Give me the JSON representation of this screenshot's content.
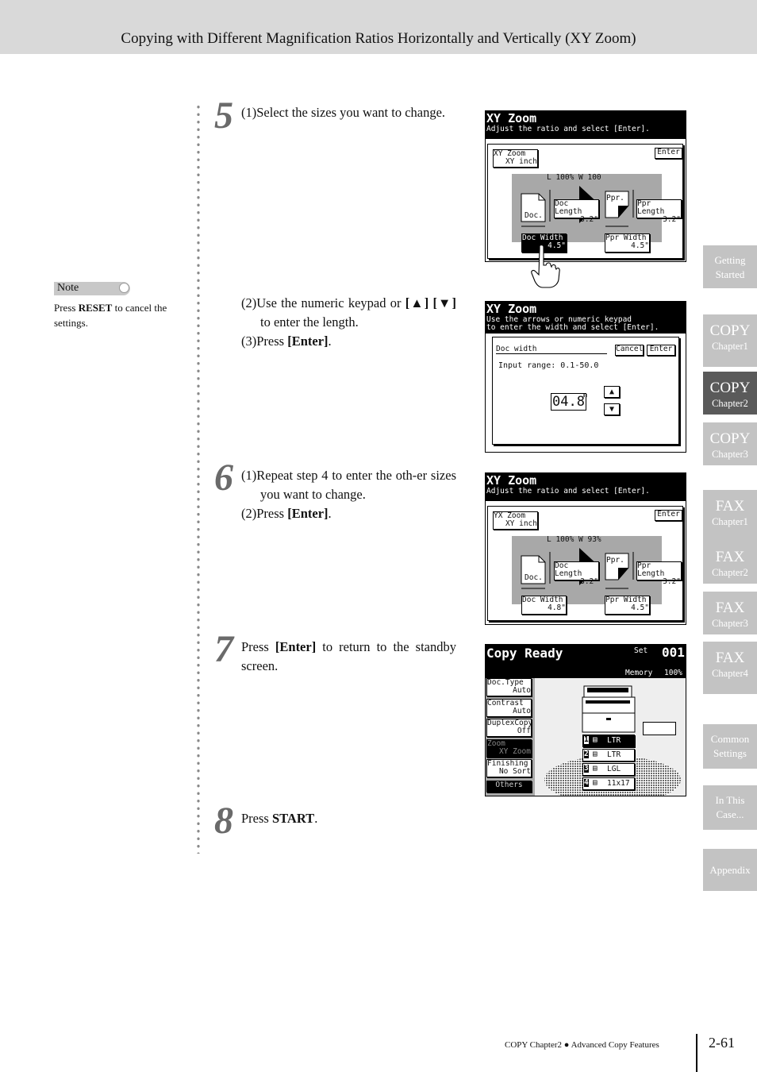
{
  "header": {
    "title": "Copying with Different Magnification Ratios Horizontally and Vertically (XY Zoom)"
  },
  "note": {
    "label": "Note",
    "text_pre": "Press ",
    "reset_key": "RESET",
    "text_post": " to cancel the settings."
  },
  "steps": {
    "s5": {
      "num": "5",
      "sub1_num": "(1)",
      "sub1": "Select the sizes you want to change.",
      "sub2_num": "(2)",
      "sub2_pre": "Use the numeric keypad or ",
      "sub2_keys": "[▲] [▼]",
      "sub2_post": " to enter the length.",
      "sub3_num": "(3)",
      "sub3_pre": "Press ",
      "sub3_key": "[Enter]",
      "sub3_post": "."
    },
    "s6": {
      "num": "6",
      "sub1_num": "(1)",
      "sub1": "Repeat step 4 to enter the oth-er sizes you want to change.",
      "sub2_num": "(2)",
      "sub2_pre": "Press ",
      "sub2_key": "[Enter]",
      "sub2_post": "."
    },
    "s7": {
      "num": "7",
      "pre": "Press ",
      "key": "[Enter]",
      "post": " to return to the standby screen."
    },
    "s8": {
      "num": "8",
      "pre": "Press ",
      "key": "START",
      "post": "."
    }
  },
  "screen1": {
    "title": "XY Zoom",
    "subtitle": "Adjust the ratio and select [Enter].",
    "mode_l1": "XY Zoom",
    "mode_l2": "XY inch",
    "enter": "Enter",
    "ratio": "L  100% W  100",
    "doc": "Doc.",
    "ppr": "Ppr.",
    "doc_length_label": "Doc Length",
    "doc_length_val": "3.2\"",
    "ppr_length_label": "Ppr Length",
    "ppr_length_val": "3.2\"",
    "doc_width_label": "Doc Width",
    "doc_width_val": "4.5\"",
    "ppr_width_label": "Ppr Width",
    "ppr_width_val": "4.5\""
  },
  "screen2": {
    "title": "XY Zoom",
    "subtitle1": "Use the arrows or numeric keypad",
    "subtitle2": "to enter the width and select [Enter].",
    "field": "Doc width",
    "cancel": "Cancel",
    "enter": "Enter",
    "range": "Input range: 0.1-50.0",
    "value": "04.8",
    "unit": "\""
  },
  "screen3": {
    "title": "XY Zoom",
    "subtitle": "Adjust the ratio and select [Enter].",
    "mode_l1": "YX Zoom",
    "mode_l2": "XY inch",
    "enter": "Enter",
    "ratio": "L  100% W   93%",
    "doc": "Doc.",
    "ppr": "Ppr.",
    "doc_length_label": "Doc Length",
    "doc_length_val": "3.2\"",
    "ppr_length_label": "Ppr Length",
    "ppr_length_val": "3.2\"",
    "doc_width_label": "Doc Width",
    "doc_width_val": "4.8\"",
    "ppr_width_label": "Ppr Width",
    "ppr_width_val": "4.5\""
  },
  "screen4": {
    "title": "Copy Ready",
    "set_label": "Set",
    "set_value": "001",
    "memory_label": "Memory",
    "memory_value": "100%",
    "items": [
      {
        "label": "Doc.Type",
        "value": "Auto"
      },
      {
        "label": "Contrast",
        "value": "Auto"
      },
      {
        "label": "DuplexCopy",
        "value": "Off"
      },
      {
        "label": "Zoom",
        "value": "XY Zoom"
      },
      {
        "label": "Finishing",
        "value": "No Sort"
      }
    ],
    "others": "Others",
    "trays": [
      {
        "num": "1",
        "size": "LTR"
      },
      {
        "num": "2",
        "size": "LTR"
      },
      {
        "num": "3",
        "size": "LGL"
      },
      {
        "num": "4",
        "size": "11x17"
      }
    ]
  },
  "tabs": [
    {
      "l1": "Getting",
      "l2": "Started"
    },
    {
      "l1": "COPY",
      "l2": "Chapter1"
    },
    {
      "l1": "COPY",
      "l2": "Chapter2"
    },
    {
      "l1": "COPY",
      "l2": "Chapter3"
    },
    {
      "l1": "FAX",
      "l2": "Chapter1"
    },
    {
      "l1": "FAX",
      "l2": "Chapter2"
    },
    {
      "l1": "FAX",
      "l2": "Chapter3"
    },
    {
      "l1": "FAX",
      "l2": "Chapter4"
    },
    {
      "l1": "Common",
      "l2": "Settings"
    },
    {
      "l1": "In This",
      "l2": "Case..."
    },
    {
      "l1": "Appendix"
    }
  ],
  "footer": {
    "chapter": "COPY Chapter2",
    "bullet": "●",
    "section": "Advanced Copy Features",
    "page": "2-61"
  }
}
